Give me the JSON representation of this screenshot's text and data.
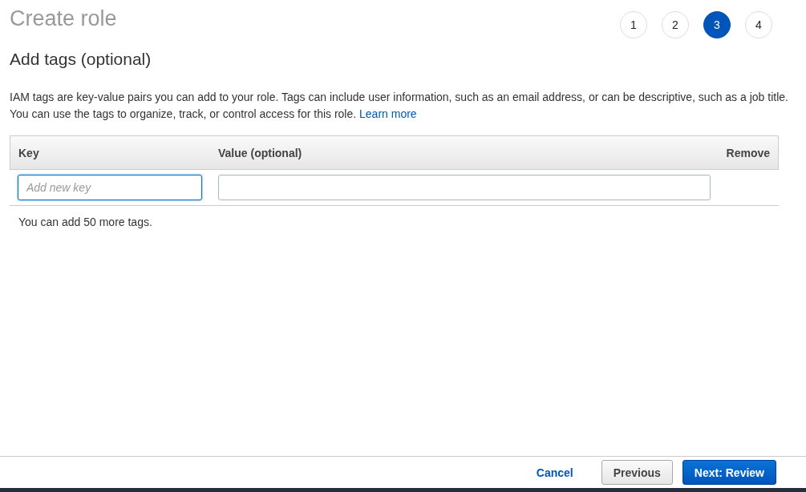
{
  "page": {
    "title": "Create role"
  },
  "steps": [
    {
      "label": "1",
      "selected": false
    },
    {
      "label": "2",
      "selected": false
    },
    {
      "label": "3",
      "selected": true
    },
    {
      "label": "4",
      "selected": false
    }
  ],
  "section": {
    "title": "Add tags (optional)",
    "description": "IAM tags are key-value pairs you can add to your role. Tags can include user information, such as an email address, or can be descriptive, such as a job title. You can use the tags to organize, track, or control access for this role.",
    "link": "Learn more"
  },
  "table": {
    "columns": [
      "Key",
      "Value (optional)",
      "Remove"
    ],
    "rows": [
      {
        "key": {
          "placeholder": "Add new key",
          "focused": true
        },
        "value": {
          "focused": false
        }
      }
    ]
  },
  "note": "You can add 50 more tags.",
  "footer": {
    "cancel": "Cancel",
    "previous": "Previous",
    "next": "Next: Review"
  }
}
